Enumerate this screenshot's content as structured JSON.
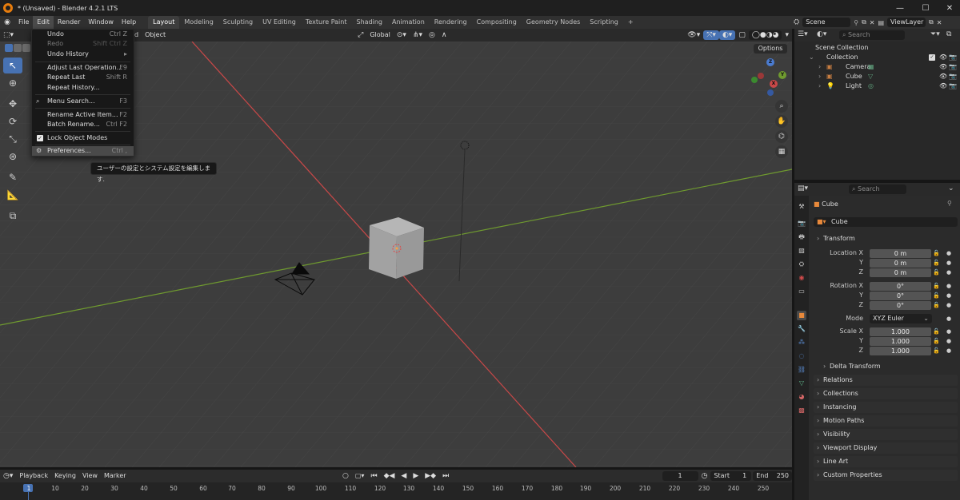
{
  "window": {
    "title": "* (Unsaved) - Blender 4.2.1 LTS",
    "minimize": "—",
    "maximize": "☐",
    "close": "✕"
  },
  "menubar": {
    "menus": [
      "File",
      "Edit",
      "Render",
      "Window",
      "Help"
    ],
    "workspaces": [
      "Layout",
      "Modeling",
      "Sculpting",
      "UV Editing",
      "Texture Paint",
      "Shading",
      "Animation",
      "Rendering",
      "Compositing",
      "Geometry Nodes",
      "Scripting"
    ],
    "add_tab": "+"
  },
  "scenebar": {
    "scene": "Scene",
    "view_layer": "ViewLayer"
  },
  "viewport_header": {
    "mode_partial": "d",
    "object_menu": "Object",
    "orientation": "Global",
    "options": "Options"
  },
  "edit_menu": {
    "items": [
      {
        "label": "Undo",
        "shortcut": "Ctrl Z"
      },
      {
        "label": "Redo",
        "shortcut": "Shift Ctrl Z"
      },
      {
        "label": "Undo History",
        "shortcut": "▸"
      },
      {
        "label": "Adjust Last Operation...",
        "shortcut": "F9"
      },
      {
        "label": "Repeat Last",
        "shortcut": "Shift R"
      },
      {
        "label": "Repeat History...",
        "shortcut": ""
      },
      {
        "label": "Menu Search...",
        "shortcut": "F3"
      },
      {
        "label": "Rename Active Item...",
        "shortcut": "F2"
      },
      {
        "label": "Batch Rename...",
        "shortcut": "Ctrl F2"
      },
      {
        "label": "Lock Object Modes",
        "shortcut": ""
      },
      {
        "label": "Preferences...",
        "shortcut": "Ctrl ,"
      }
    ],
    "tooltip": "ユーザーの設定とシステム設定を編集します."
  },
  "gizmo": {
    "x": "X",
    "y": "Y",
    "z": "Z"
  },
  "outliner": {
    "search_placeholder": "Search",
    "scene_collection": "Scene Collection",
    "collection": "Collection",
    "objects": [
      "Camera",
      "Cube",
      "Light"
    ]
  },
  "properties": {
    "search_placeholder": "Search",
    "object_name": "Cube",
    "data_name": "Cube",
    "transform_label": "Transform",
    "location": {
      "label_x": "Location X",
      "label_y": "Y",
      "label_z": "Z",
      "x": "0 m",
      "y": "0 m",
      "z": "0 m"
    },
    "rotation": {
      "label_x": "Rotation X",
      "label_y": "Y",
      "label_z": "Z",
      "x": "0°",
      "y": "0°",
      "z": "0°"
    },
    "mode": {
      "label": "Mode",
      "value": "XYZ Euler"
    },
    "scale": {
      "label_x": "Scale X",
      "label_y": "Y",
      "label_z": "Z",
      "x": "1.000",
      "y": "1.000",
      "z": "1.000"
    },
    "delta_transform": "Delta Transform",
    "panels": [
      "Relations",
      "Collections",
      "Instancing",
      "Motion Paths",
      "Visibility",
      "Viewport Display",
      "Line Art",
      "Custom Properties"
    ]
  },
  "timeline": {
    "menus": [
      "Playback",
      "Keying",
      "View",
      "Marker"
    ],
    "current_frame": "1",
    "start_label": "Start",
    "start": "1",
    "end_label": "End",
    "end": "250",
    "ticks": [
      "1",
      "10",
      "20",
      "30",
      "40",
      "50",
      "60",
      "70",
      "80",
      "90",
      "100",
      "110",
      "120",
      "130",
      "140",
      "150",
      "160",
      "170",
      "180",
      "190",
      "200",
      "210",
      "220",
      "230",
      "240",
      "250"
    ]
  },
  "colors": {
    "accent": "#4772b3",
    "x_axis": "#c94848",
    "y_axis": "#6f9a2f",
    "z_axis": "#4a7bd0",
    "brand": "#e87d0d"
  }
}
